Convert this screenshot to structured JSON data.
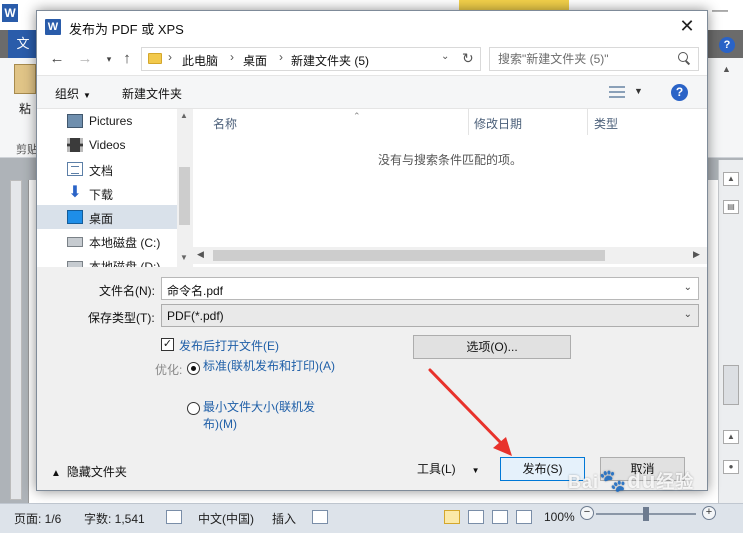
{
  "background_app": {
    "file_tab": "文",
    "paste_label": "粘",
    "clipboard_label": "剪贴",
    "status_bar": {
      "page": "页面: 1/6",
      "words": "字数: 1,541",
      "language": "中文(中国)",
      "insert_mode": "插入",
      "zoom": "100%"
    }
  },
  "dialog": {
    "title": "发布为 PDF 或 XPS",
    "address": {
      "crumbs": [
        "此电脑",
        "桌面",
        "新建文件夹 (5)"
      ]
    },
    "search": {
      "placeholder": "搜索\"新建文件夹 (5)\""
    },
    "toolbar": {
      "organize": "组织",
      "new_folder": "新建文件夹"
    },
    "nav_pane": {
      "items": [
        {
          "label": "Pictures",
          "icon": "pictures-icon"
        },
        {
          "label": "Videos",
          "icon": "videos-icon"
        },
        {
          "label": "文档",
          "icon": "documents-icon"
        },
        {
          "label": "下载",
          "icon": "download-icon"
        },
        {
          "label": "桌面",
          "icon": "desktop-icon",
          "selected": true
        },
        {
          "label": "本地磁盘 (C:)",
          "icon": "disk-icon"
        },
        {
          "label": "本地磁盘 (D:)",
          "icon": "disk-icon"
        }
      ]
    },
    "file_list": {
      "columns": [
        "名称",
        "修改日期",
        "类型"
      ],
      "empty_message": "没有与搜索条件匹配的项。"
    },
    "form": {
      "filename_label": "文件名(N):",
      "filename_value": "命令名.pdf",
      "filetype_label": "保存类型(T):",
      "filetype_value": "PDF(*.pdf)"
    },
    "open_after_publish": {
      "label": "发布后打开文件(E)",
      "checked": true
    },
    "optimize": {
      "label": "优化:",
      "options": [
        {
          "label": "标准(联机发布和打印)(A)",
          "selected": true
        },
        {
          "label": "最小文件大小(联机发布)(M)",
          "selected": false
        }
      ]
    },
    "options_button": "选项(O)...",
    "hide_folders": "隐藏文件夹",
    "tools": "工具(L)",
    "publish_button": "发布(S)",
    "cancel_button": "取消"
  },
  "watermark": {
    "text": "Bai",
    "suffix": "经验"
  },
  "colors": {
    "accent": "#0078d7",
    "link_text": "#1f5fa8",
    "selected_nav": "#d9e1ea",
    "annotation_arrow": "#e8322b",
    "word_brand": "#2a5caa"
  }
}
